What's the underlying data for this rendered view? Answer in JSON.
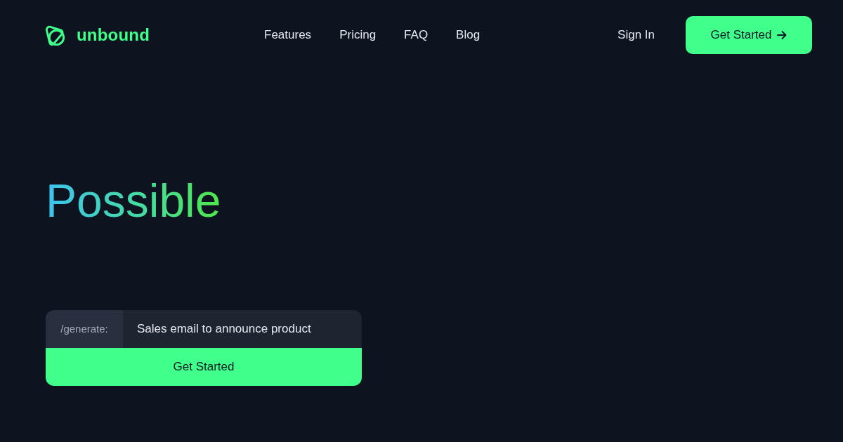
{
  "navbar": {
    "brand": "unbound",
    "links": [
      "Features",
      "Pricing",
      "FAQ",
      "Blog"
    ],
    "sign_in": "Sign In",
    "cta": "Get Started"
  },
  "hero": {
    "headline": "Possible",
    "prompt": {
      "prefix": "/generate:",
      "value": "Sales email to announce product",
      "button": "Get Started"
    }
  }
}
